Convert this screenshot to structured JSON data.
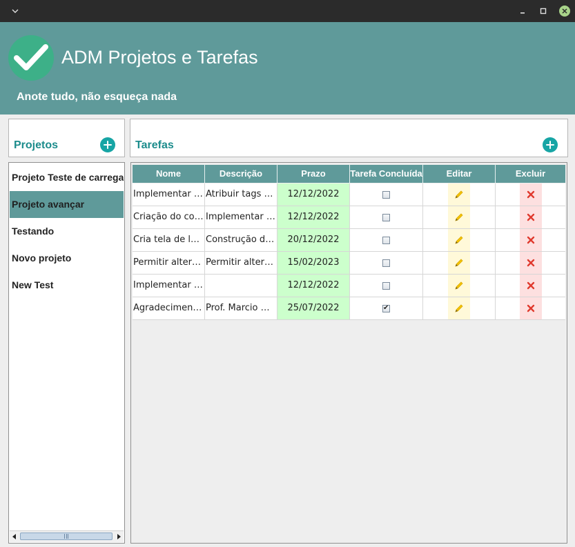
{
  "header": {
    "title": "ADM Projetos e Tarefas",
    "subtitle": "Anote tudo, não esqueça nada",
    "accent_color": "#5f9a9a"
  },
  "projects": {
    "label": "Projetos",
    "add_icon": "plus-circle-icon",
    "items": [
      {
        "label": "Projeto Teste de carregamento"
      },
      {
        "label": "Projeto avançar",
        "selected": true
      },
      {
        "label": "Testando"
      },
      {
        "label": "Novo projeto"
      },
      {
        "label": "New Test"
      }
    ]
  },
  "tasks": {
    "label": "Tarefas",
    "add_icon": "plus-circle-icon",
    "columns": [
      "Nome",
      "Descrição",
      "Prazo",
      "Tarefa Concluída",
      "Editar",
      "Excluir"
    ],
    "rows": [
      {
        "nome": "Implementar tags",
        "descricao": "Atribuir tags a tarefas",
        "prazo": "12/12/2022",
        "concluida": false
      },
      {
        "nome": "Criação do componente",
        "descricao": "Implementar componente",
        "prazo": "12/12/2022",
        "concluida": false
      },
      {
        "nome": "Cria tela de login",
        "descricao": "Construção da tela",
        "prazo": "20/12/2022",
        "concluida": false
      },
      {
        "nome": "Permitir alteração",
        "descricao": "Permitir alteração de dados",
        "prazo": "15/02/2023",
        "concluida": false
      },
      {
        "nome": "Implementar filtros",
        "descricao": "",
        "prazo": "12/12/2022",
        "concluida": false
      },
      {
        "nome": "Agradecimentos",
        "descricao": "Prof. Marcio Michelluzzi",
        "prazo": "25/07/2022",
        "concluida": true
      }
    ]
  }
}
